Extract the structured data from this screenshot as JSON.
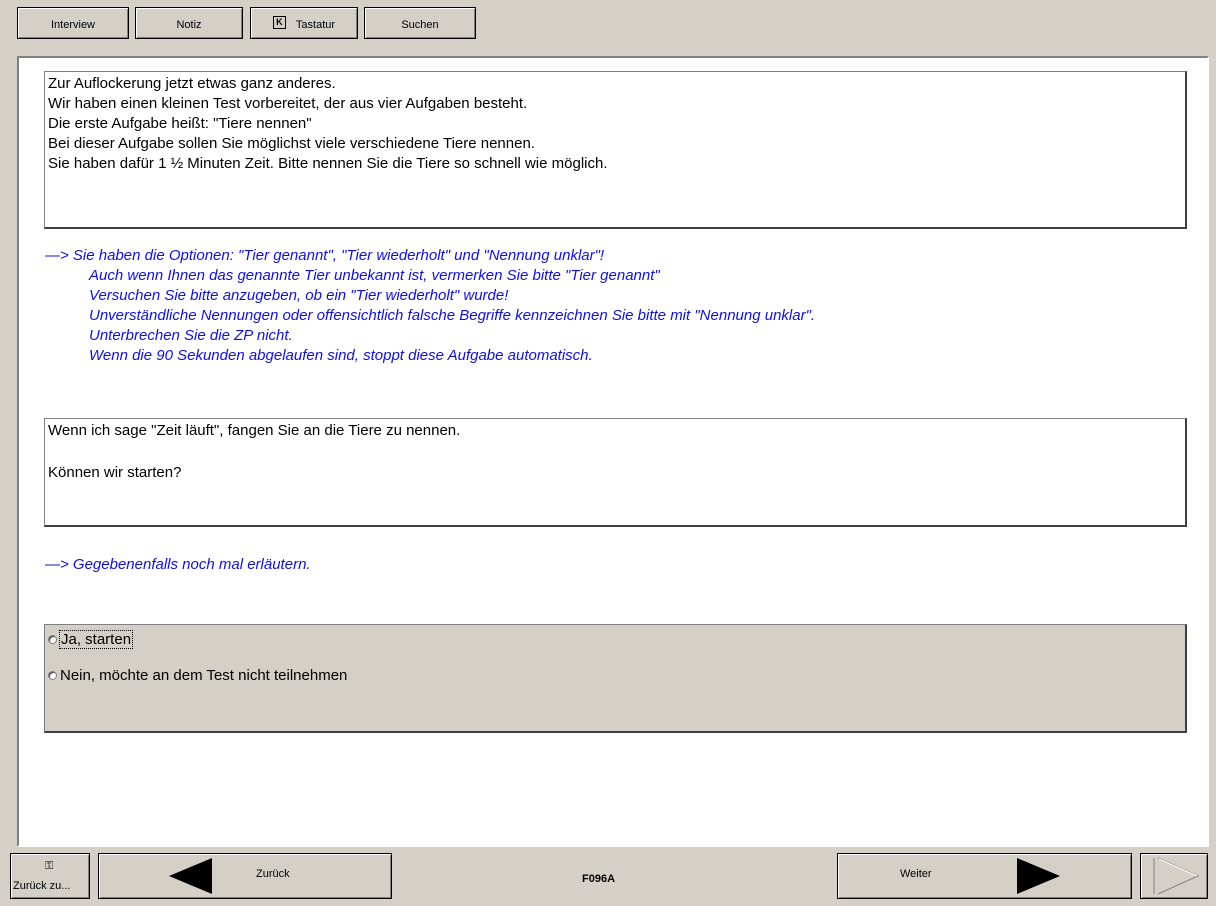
{
  "toolbar": {
    "interview": "Interview",
    "notiz": "Notiz",
    "tastatur": "Tastatur",
    "tastatur_key": "K",
    "suchen": "Suchen"
  },
  "question": {
    "lines": [
      "Zur Auflockerung jetzt etwas ganz anderes.",
      "Wir haben einen kleinen Test vorbereitet, der aus vier Aufgaben besteht.",
      "Die erste Aufgabe heißt: \"Tiere nennen\"",
      "Bei dieser Aufgabe sollen Sie möglichst viele verschiedene Tiere nennen.",
      "Sie haben dafür 1 ½ Minuten Zeit. Bitte nennen Sie die Tiere so schnell wie möglich."
    ]
  },
  "interviewer_hint_1": [
    "—>  Sie haben die Optionen: \"Tier genannt\", \"Tier wiederholt\" und \"Nennung unklar\"!",
    "Auch wenn Ihnen das genannte Tier unbekannt ist, vermerken Sie bitte \"Tier genannt\"",
    "Versuchen Sie bitte anzugeben, ob ein \"Tier wiederholt\" wurde!",
    "Unverständliche Nennungen oder offensichtlich falsche Begriffe kennzeichnen Sie bitte mit \"Nennung unklar\".",
    "Unterbrechen Sie die ZP nicht.",
    "Wenn die 90 Sekunden abgelaufen sind, stoppt diese Aufgabe automatisch."
  ],
  "question2": {
    "line1": "Wenn ich sage \"Zeit läuft\", fangen Sie an die Tiere zu nennen.",
    "line2": "Können wir starten?"
  },
  "interviewer_hint_2": "—>  Gegebenenfalls noch mal erläutern.",
  "answers": [
    {
      "label": "Ja, starten",
      "selected": false
    },
    {
      "label": "Nein, möchte an dem Test nicht teilnehmen",
      "selected": false
    }
  ],
  "footer": {
    "zurueck_zu": "Zurück zu...",
    "zurueck": "Zurück",
    "question_id": "F096A",
    "weiter": "Weiter"
  }
}
